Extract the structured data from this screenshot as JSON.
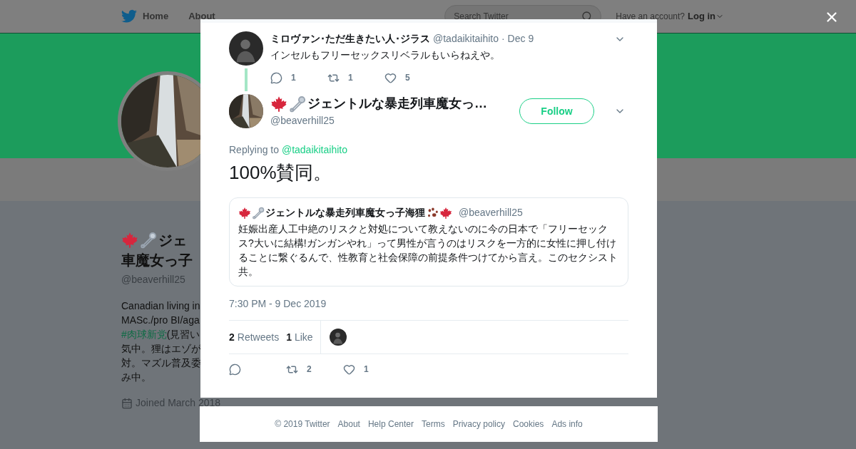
{
  "nav": {
    "home": "Home",
    "about": "About",
    "search_placeholder": "Search Twitter",
    "account_prompt": "Have an account?",
    "login": "Log in"
  },
  "profile": {
    "name_lines": [
      "ジェ",
      "車魔女っ子"
    ],
    "handle": "@beaverhill25",
    "bio": [
      {
        "text": "Canadian living in"
      },
      {
        "text": "MASc./pro BI/aga"
      },
      {
        "link": "#肉球新党",
        "text": "(見習い"
      },
      {
        "text": "気中。狸はエゾが"
      },
      {
        "text": "対。マズル普及委"
      },
      {
        "text": "み中。"
      }
    ],
    "joined": "Joined March 2018"
  },
  "parent_tweet": {
    "name": "ミロヴァン･ただ生きたい人･ジラス",
    "handle": "@tadaikitaihito",
    "date": "· Dec 9",
    "text": "インセルもフリーセックスリベラルもいらねえや。",
    "actions": [
      {
        "kind": "reply",
        "count": "1"
      },
      {
        "kind": "retweet",
        "count": "1"
      },
      {
        "kind": "like",
        "count": "5"
      }
    ]
  },
  "main_tweet": {
    "name": "ジェントルな暴走列車魔女っ…",
    "handle": "@beaverhill25",
    "follow": "Follow",
    "replying_label": "Replying to",
    "replying_to": "@tadaikitaihito",
    "text": "100%賛同。",
    "quote": {
      "name": "ジェントルな暴走列車魔女っ子海狸",
      "handle": "@beaverhill25",
      "text": "妊娠出産人工中絶のリスクと対処について教えないのに今の日本で「フリーセックス?大いに結構!ガンガンやれ」って男性が言うのはリスクを一方的に女性に押し付けることに繋ぐるんで、性教育と社会保障の前提条件つけてから言え。このセクシスト共。"
    },
    "timestamp": "7:30 PM - 9 Dec 2019",
    "stats": [
      {
        "count": "2",
        "label": "Retweets"
      },
      {
        "count": "1",
        "label": "Like"
      }
    ],
    "actions": [
      {
        "kind": "reply"
      },
      {
        "kind": "retweet",
        "count": "2"
      },
      {
        "kind": "like",
        "count": "1"
      }
    ]
  },
  "footer": [
    "© 2019 Twitter",
    "About",
    "Help Center",
    "Terms",
    "Privacy policy",
    "Cookies",
    "Ads info"
  ]
}
